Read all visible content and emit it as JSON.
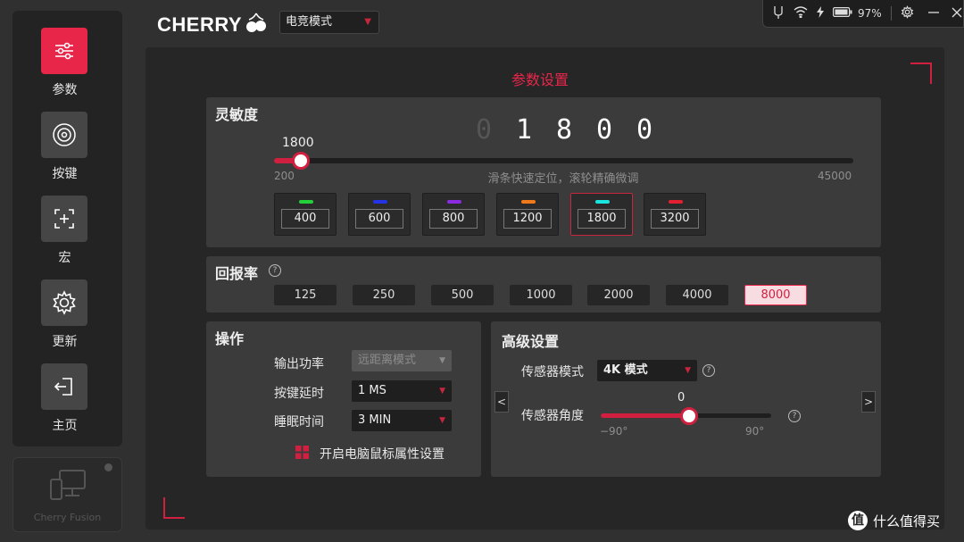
{
  "nav": {
    "items": [
      {
        "label": "参数",
        "icon": "sliders-icon",
        "active": true
      },
      {
        "label": "按键",
        "icon": "target-icon"
      },
      {
        "label": "宏",
        "icon": "macro-add-icon"
      },
      {
        "label": "更新",
        "icon": "gear-icon"
      },
      {
        "label": "主页",
        "icon": "exit-icon"
      }
    ]
  },
  "device": {
    "label": "Cherry Fusion"
  },
  "brand": {
    "name": "CHERRY"
  },
  "mode": {
    "value": "电竞模式"
  },
  "status": {
    "battery": "97%"
  },
  "page": {
    "title": "参数设置"
  },
  "sensitivity": {
    "title": "灵敏度",
    "digits": [
      "0",
      "1",
      "8",
      "0",
      "0"
    ],
    "current": "1800",
    "min": "200",
    "max": "45000",
    "hint": "滑条快速定位，滚轮精确微调",
    "value": 1800,
    "presets": [
      {
        "value": "400",
        "color": "#22d13a"
      },
      {
        "value": "600",
        "color": "#2433e8"
      },
      {
        "value": "800",
        "color": "#8a2be2"
      },
      {
        "value": "1200",
        "color": "#f07a1a"
      },
      {
        "value": "1800",
        "color": "#19e6e0",
        "active": true
      },
      {
        "value": "3200",
        "color": "#e3202f"
      }
    ]
  },
  "polling": {
    "title": "回报率",
    "rates": [
      "125",
      "250",
      "500",
      "1000",
      "2000",
      "4000",
      "8000"
    ],
    "selected": "8000"
  },
  "operation": {
    "title": "操作",
    "rows": [
      {
        "label": "输出功率",
        "value": "远距离模式",
        "disabled": true
      },
      {
        "label": "按键延时",
        "value": "1 MS"
      },
      {
        "label": "睡眠时间",
        "value": "3 MIN"
      }
    ],
    "link": "开启电脑鼠标属性设置"
  },
  "advanced": {
    "title": "高级设置",
    "sensor_mode_label": "传感器模式",
    "sensor_mode_value": "4K 模式",
    "angle_label": "传感器角度",
    "angle_value": "0",
    "angle_min": "−90°",
    "angle_max": "90°",
    "angle_fraction": 0.5,
    "prev": "<",
    "next": ">"
  },
  "watermark": {
    "icon_letter": "值",
    "text": "什么值得买"
  },
  "colors": {
    "accent": "#e8264a"
  }
}
